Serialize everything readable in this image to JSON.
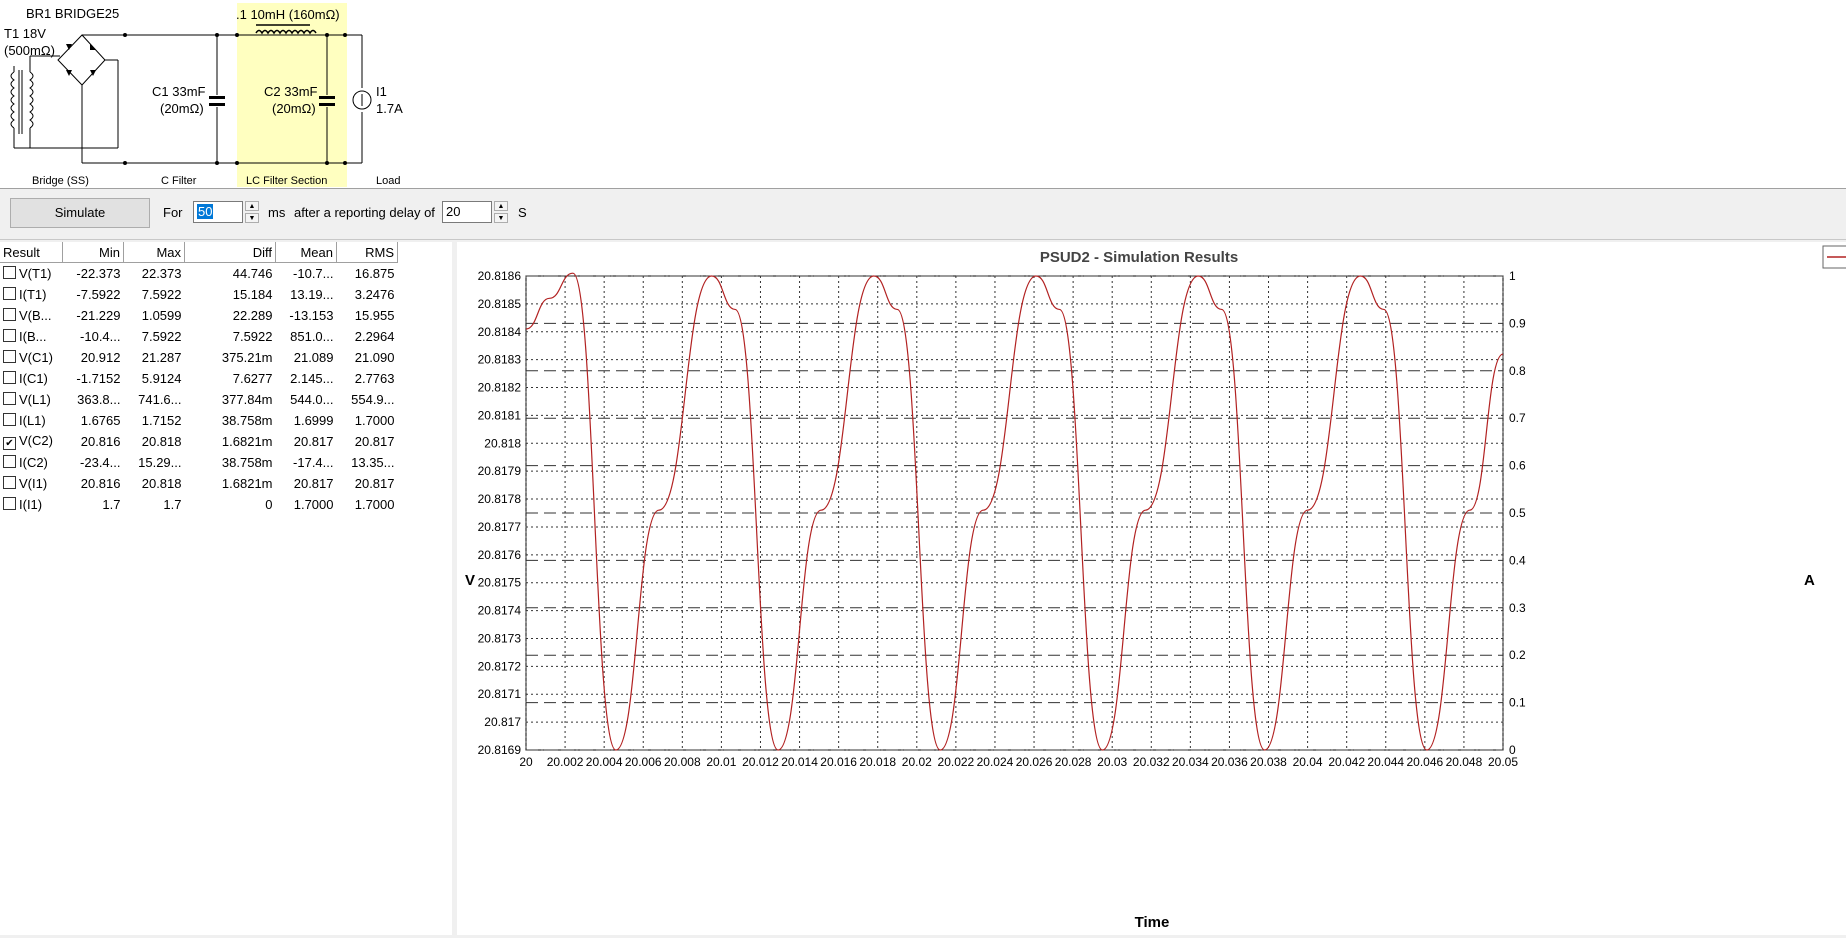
{
  "circuit": {
    "rectifier_label": "BR1 BRIDGE25",
    "transformer_label": "T1 18V",
    "transformer_resistance": "(500mΩ)",
    "c1_label": "C1 33mF",
    "c1_resistance": "(20mΩ)",
    "inductor_label": ".1 10mH (160mΩ)",
    "c2_label": "C2 33mF",
    "c2_resistance": "(20mΩ)",
    "load_label": "I1",
    "load_value": "1.7A",
    "sections": [
      "Bridge (SS)",
      "C Filter",
      "LC Filter Section",
      "Load"
    ],
    "highlight_color": "#ffffc0"
  },
  "toolbar": {
    "simulate_label": "Simulate",
    "for_label": "For",
    "duration_value": "50",
    "duration_unit": "ms",
    "delay_label": "after a reporting delay of",
    "delay_value": "20",
    "delay_unit": "S"
  },
  "results": {
    "headers": [
      "Result",
      "Min",
      "Max",
      "Diff",
      "Mean",
      "RMS"
    ],
    "rows": [
      {
        "name": "V(T1)",
        "min": "-22.373",
        "max": "22.373",
        "diff": "44.746",
        "mean": "-10.7...",
        "rms": "16.875",
        "checked": false
      },
      {
        "name": "I(T1)",
        "min": "-7.5922",
        "max": "7.5922",
        "diff": "15.184",
        "mean": "13.19...",
        "rms": "3.2476",
        "checked": false
      },
      {
        "name": "V(B...",
        "min": "-21.229",
        "max": "1.0599",
        "diff": "22.289",
        "mean": "-13.153",
        "rms": "15.955",
        "checked": false
      },
      {
        "name": "I(B...",
        "min": "-10.4...",
        "max": "7.5922",
        "diff": "7.5922",
        "mean": "851.0...",
        "rms": "2.2964",
        "checked": false
      },
      {
        "name": "V(C1)",
        "min": "20.912",
        "max": "21.287",
        "diff": "375.21m",
        "mean": "21.089",
        "rms": "21.090",
        "checked": false
      },
      {
        "name": "I(C1)",
        "min": "-1.7152",
        "max": "5.9124",
        "diff": "7.6277",
        "mean": "2.145...",
        "rms": "2.7763",
        "checked": false
      },
      {
        "name": "V(L1)",
        "min": "363.8...",
        "max": "741.6...",
        "diff": "377.84m",
        "mean": "544.0...",
        "rms": "554.9...",
        "checked": false
      },
      {
        "name": "I(L1)",
        "min": "1.6765",
        "max": "1.7152",
        "diff": "38.758m",
        "mean": "1.6999",
        "rms": "1.7000",
        "checked": false
      },
      {
        "name": "V(C2)",
        "min": "20.816",
        "max": "20.818",
        "diff": "1.6821m",
        "mean": "20.817",
        "rms": "20.817",
        "checked": true
      },
      {
        "name": "I(C2)",
        "min": "-23.4...",
        "max": "15.29...",
        "diff": "38.758m",
        "mean": "-17.4...",
        "rms": "13.35...",
        "checked": false
      },
      {
        "name": "V(I1)",
        "min": "20.816",
        "max": "20.818",
        "diff": "1.6821m",
        "mean": "20.817",
        "rms": "20.817",
        "checked": false
      },
      {
        "name": "I(I1)",
        "min": "1.7",
        "max": "1.7",
        "diff": "0",
        "mean": "1.7000",
        "rms": "1.7000",
        "checked": false
      }
    ]
  },
  "chart_data": {
    "type": "line",
    "title": "PSUD2 - Simulation Results",
    "xlabel": "Time",
    "ylabel": "V",
    "y2label": "A",
    "xlim": [
      20,
      20.05
    ],
    "ylim": [
      20.8169,
      20.8186
    ],
    "y2lim": [
      0,
      1
    ],
    "x_ticks": [
      "20",
      "20.002",
      "20.004",
      "20.006",
      "20.008",
      "20.01",
      "20.012",
      "20.014",
      "20.016",
      "20.018",
      "20.02",
      "20.022",
      "20.024",
      "20.026",
      "20.028",
      "20.03",
      "20.032",
      "20.034",
      "20.036",
      "20.038",
      "20.04",
      "20.042",
      "20.044",
      "20.046",
      "20.048",
      "20.05"
    ],
    "y_ticks": [
      "20.8169",
      "20.817",
      "20.8171",
      "20.8172",
      "20.8173",
      "20.8174",
      "20.8175",
      "20.8176",
      "20.8177",
      "20.8178",
      "20.8179",
      "20.818",
      "20.8181",
      "20.8182",
      "20.8183",
      "20.8184",
      "20.8185",
      "20.8186"
    ],
    "y2_ticks": [
      "0",
      "0.1",
      "0.2",
      "0.3",
      "0.4",
      "0.5",
      "0.6",
      "0.7",
      "0.8",
      "0.9",
      "1"
    ],
    "grid": true,
    "series": [
      {
        "color": "#b22222",
        "x": [
          20,
          20.0012,
          20.0024,
          20.0046,
          20.0068,
          20.0095,
          20.0107,
          20.0129,
          20.0151,
          20.0178,
          20.019,
          20.0212,
          20.0234,
          20.0261,
          20.0273,
          20.0295,
          20.0317,
          20.0344,
          20.0356,
          20.0378,
          20.04,
          20.0427,
          20.0439,
          20.0461,
          20.0483,
          20.05
        ],
        "y": [
          20.81841,
          20.81852,
          20.81861,
          20.8169,
          20.81776,
          20.8186,
          20.81848,
          20.8169,
          20.81776,
          20.8186,
          20.81848,
          20.8169,
          20.81776,
          20.8186,
          20.81848,
          20.8169,
          20.81776,
          20.8186,
          20.81848,
          20.8169,
          20.81776,
          20.8186,
          20.81848,
          20.8169,
          20.81776,
          20.81832
        ]
      }
    ]
  }
}
